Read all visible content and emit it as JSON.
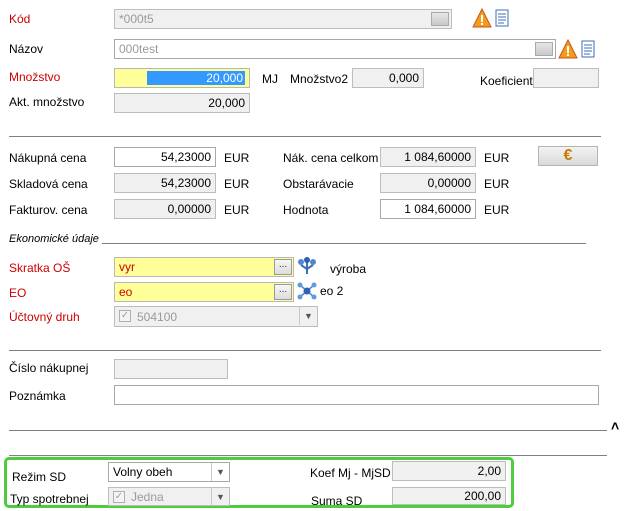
{
  "header": {
    "kod_label": "Kód",
    "kod_value": "*000t5",
    "nazov_label": "Názov",
    "nazov_value": "000test",
    "mnozstvo_label": "Množstvo",
    "mnozstvo_value": "20,000",
    "mj_label": "MJ",
    "mnozstvo2_label": "Množstvo2",
    "mnozstvo2_value": "0,000",
    "koeficient_label": "Koeficient",
    "koeficient_value": "",
    "akt_mnozstvo_label": "Akt. množstvo",
    "akt_mnozstvo_value": "20,000"
  },
  "prices": {
    "nakupna_label": "Nákupná cena",
    "nakupna_value": "54,23000",
    "nakupna_currency": "EUR",
    "skladova_label": "Skladová cena",
    "skladova_value": "54,23000",
    "skladova_currency": "EUR",
    "fakturov_label": "Fakturov. cena",
    "fakturov_value": "0,00000",
    "fakturov_currency": "EUR",
    "nak_celkom_label": "Nák. cena celkom",
    "nak_celkom_value": "1 084,60000",
    "nak_celkom_currency": "EUR",
    "obstaravacie_label": "Obstarávacie",
    "obstaravacie_value": "0,00000",
    "obstaravacie_currency": "EUR",
    "hodnota_label": "Hodnota",
    "hodnota_value": "1 084,60000",
    "hodnota_currency": "EUR",
    "euro_symbol": "€"
  },
  "economic": {
    "section_title": "Ekonomické údaje",
    "skratka_label": "Skratka OŠ",
    "skratka_value": "vyr",
    "skratka_desc": "výroba",
    "eo_label": "EO",
    "eo_value": "eo",
    "eo_desc": "eo 2",
    "uctovny_label": "Účtovný druh",
    "uctovny_value": "504100",
    "dots": "..."
  },
  "misc": {
    "cislo_label": "Číslo nákupnej",
    "cislo_value": "",
    "poznamka_label": "Poznámka",
    "poznamka_value": "",
    "caret": "˄"
  },
  "sd": {
    "rezim_label": "Režim SD",
    "rezim_value": "Volny obeh",
    "typ_label": "Typ spotrebnej",
    "typ_value": "Jedna",
    "koef_label": "Koef Mj - MjSD",
    "koef_value": "2,00",
    "suma_label": "Suma SD",
    "suma_value": "200,00"
  },
  "colors": {
    "required_label": "#cc0000",
    "highlight_border": "#4ccd3c",
    "yellow_field": "#ffff99",
    "selection": "#3399ff"
  },
  "icons": [
    "warning-icon",
    "document-icon",
    "tree-icon",
    "network-icon",
    "euro-icon",
    "checkbox-icon",
    "chevron-down-icon"
  ]
}
